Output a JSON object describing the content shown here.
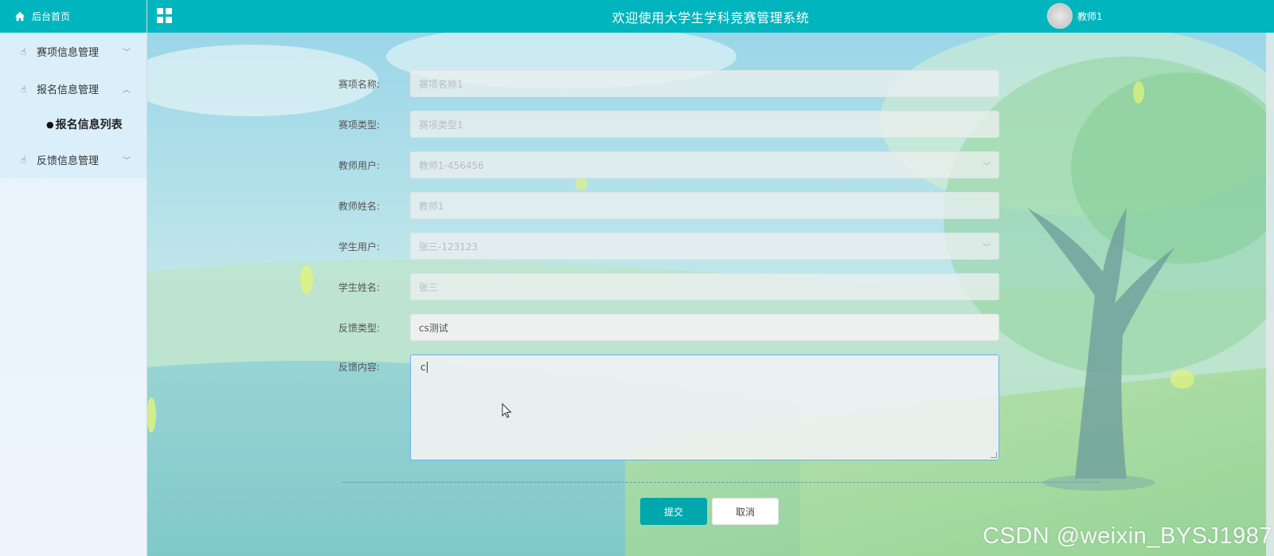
{
  "sidebar": {
    "home_label": "后台首页",
    "menus": [
      {
        "label": "赛项信息管理",
        "expanded": false
      },
      {
        "label": "报名信息管理",
        "expanded": true,
        "children": [
          "报名信息列表"
        ]
      },
      {
        "label": "反馈信息管理",
        "expanded": false
      }
    ]
  },
  "header": {
    "title": "欢迎使用大学生学科竞赛管理系统",
    "user_name": "教师1"
  },
  "form": {
    "fields": [
      {
        "label": "赛项名称:",
        "value": "赛项名称1",
        "type": "text",
        "disabled": true
      },
      {
        "label": "赛项类型:",
        "value": "赛项类型1",
        "type": "text",
        "disabled": true
      },
      {
        "label": "教师用户:",
        "value": "教师1-456456",
        "type": "select",
        "disabled": true
      },
      {
        "label": "教师姓名:",
        "value": "教师1",
        "type": "text",
        "disabled": true
      },
      {
        "label": "学生用户:",
        "value": "张三-123123",
        "type": "select",
        "disabled": true
      },
      {
        "label": "学生姓名:",
        "value": "张三",
        "type": "text",
        "disabled": true
      },
      {
        "label": "反馈类型:",
        "value": "cs测试",
        "type": "text",
        "disabled": false
      },
      {
        "label": "反馈内容:",
        "value": "c",
        "type": "textarea",
        "disabled": false
      }
    ],
    "submit_label": "提交",
    "cancel_label": "取消"
  },
  "watermark": "CSDN @weixin_BYSJ1987",
  "colors": {
    "primary": "#00b5bd",
    "submit": "#00a8ae",
    "focus_border": "#6fb1e9"
  }
}
